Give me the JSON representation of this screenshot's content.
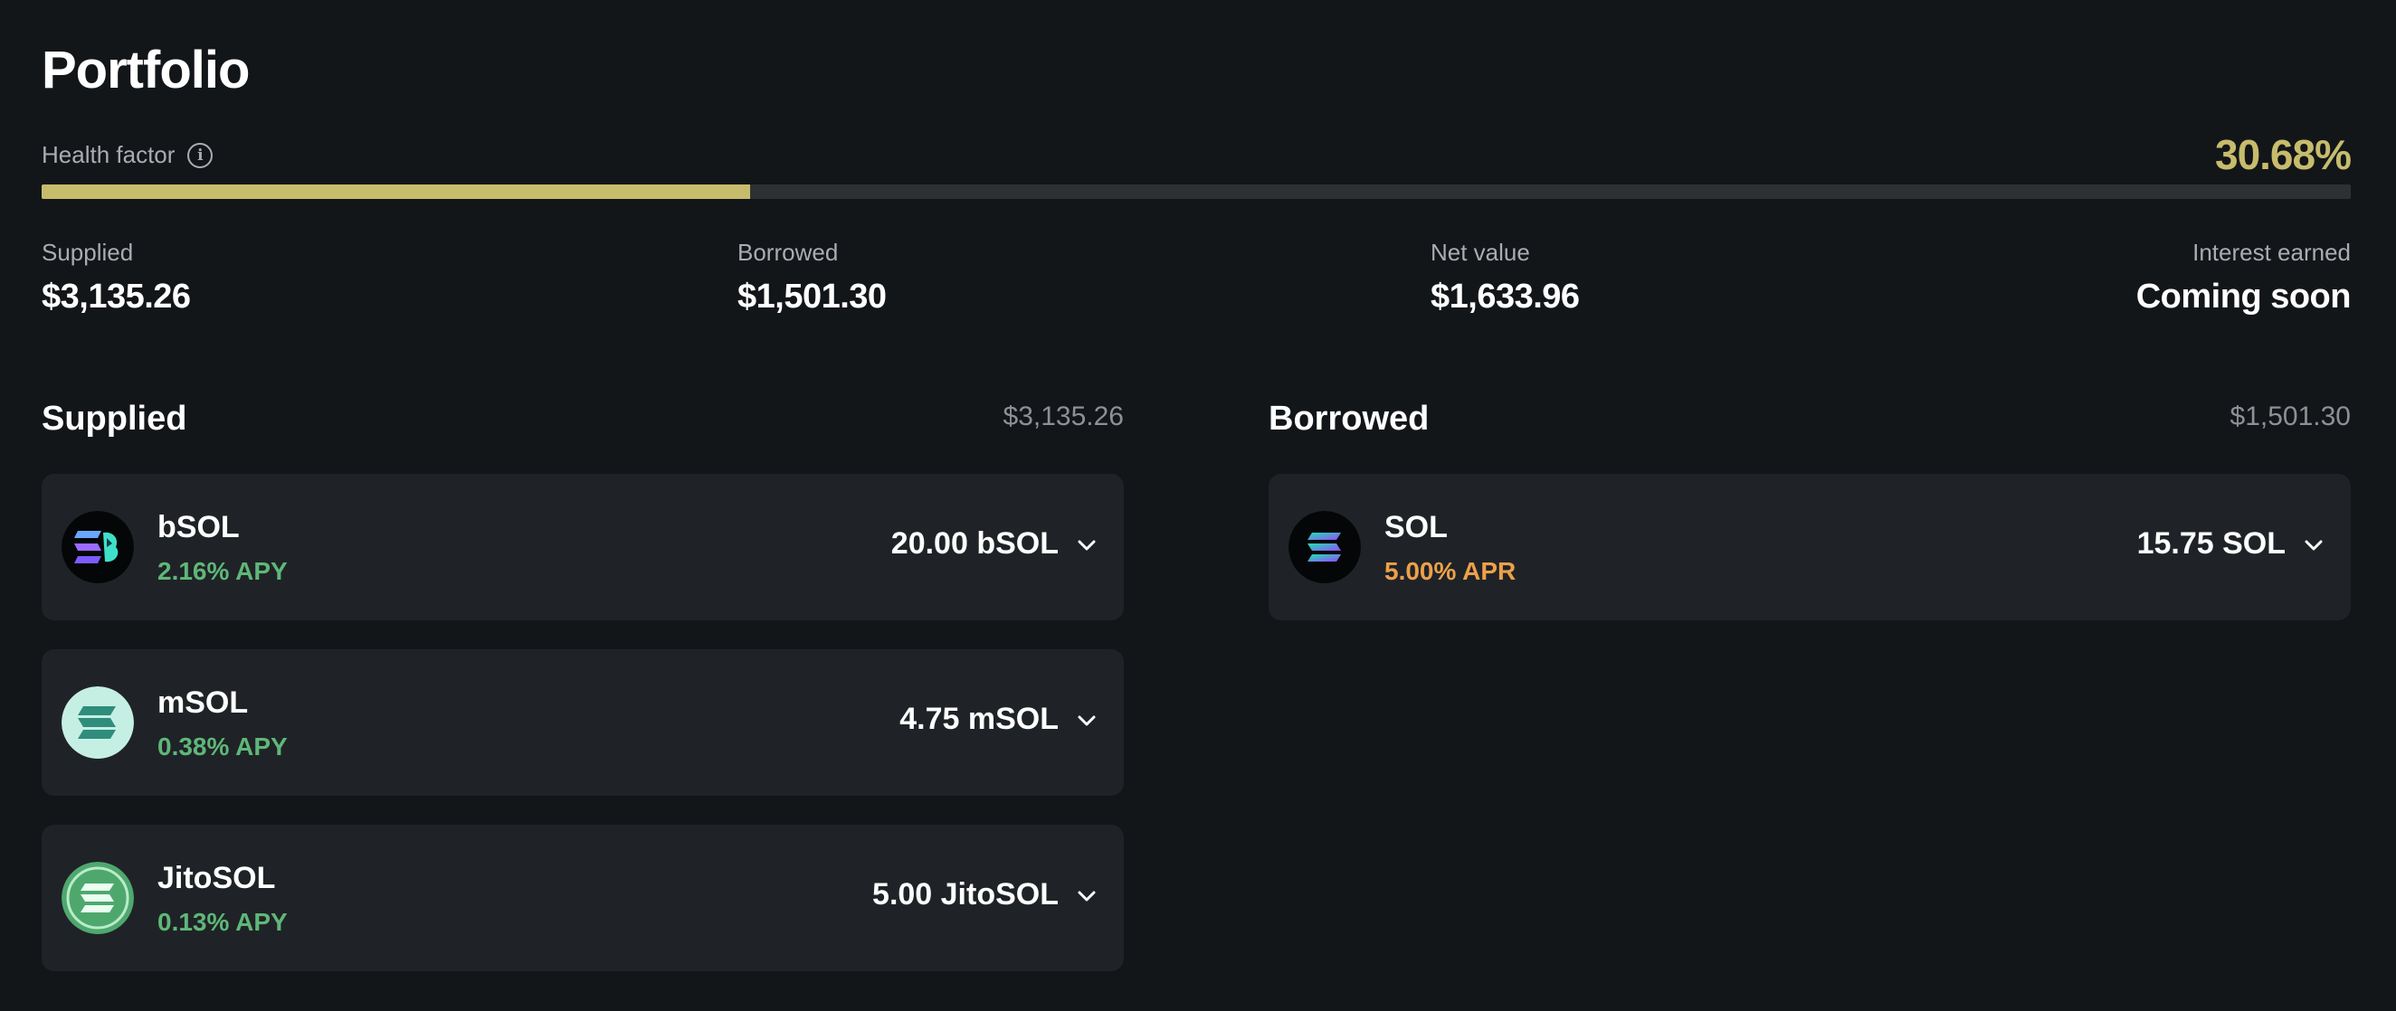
{
  "page": {
    "title": "Portfolio"
  },
  "health": {
    "label": "Health factor",
    "value_text": "30.68%",
    "fraction": 0.3068,
    "color": "#c7bc6c"
  },
  "stats": {
    "supplied": {
      "label": "Supplied",
      "value": "$3,135.26"
    },
    "borrowed": {
      "label": "Borrowed",
      "value": "$1,501.30"
    },
    "net_value": {
      "label": "Net value",
      "value": "$1,633.96"
    },
    "interest": {
      "label": "Interest earned",
      "value": "Coming soon"
    }
  },
  "supplied_section": {
    "title": "Supplied",
    "total": "$3,135.26",
    "items": [
      {
        "name": "bSOL",
        "rate": "2.16% APY",
        "amount": "20.00 bSOL",
        "icon": "bsol-logo-icon"
      },
      {
        "name": "mSOL",
        "rate": "0.38% APY",
        "amount": "4.75 mSOL",
        "icon": "msol-logo-icon"
      },
      {
        "name": "JitoSOL",
        "rate": "0.13% APY",
        "amount": "5.00 JitoSOL",
        "icon": "jitosol-logo-icon"
      }
    ]
  },
  "borrowed_section": {
    "title": "Borrowed",
    "total": "$1,501.30",
    "items": [
      {
        "name": "SOL",
        "rate": "5.00% APR",
        "amount": "15.75 SOL",
        "icon": "sol-logo-icon"
      }
    ]
  },
  "colors": {
    "background": "#131619",
    "card": "#1f2327",
    "apy_green": "#5fb778",
    "apr_orange": "#eda04a",
    "health_gold": "#c7bc6c"
  }
}
